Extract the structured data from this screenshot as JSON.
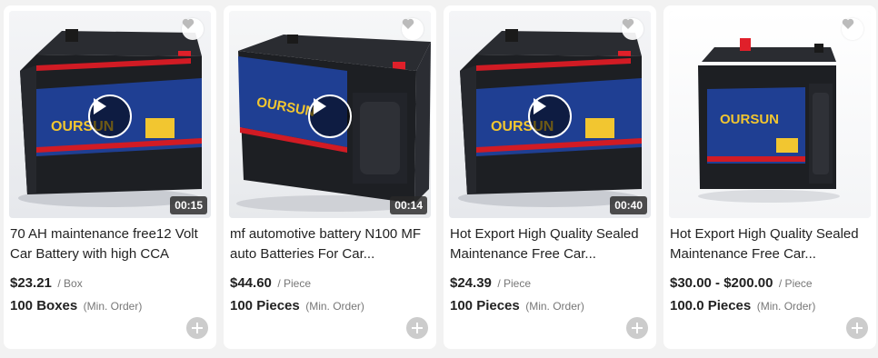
{
  "products": [
    {
      "title": "70 AH maintenance free12 Volt Car Battery with high CCA",
      "price": "$23.21",
      "unit": "/ Box",
      "moq": "100 Boxes",
      "moq_note": "(Min. Order)",
      "duration": "00:15",
      "has_video": true,
      "image_icon": "car-battery-image"
    },
    {
      "title": "mf automotive battery N100 MF auto Batteries For Car...",
      "price": "$44.60",
      "unit": "/ Piece",
      "moq": "100 Pieces",
      "moq_note": "(Min. Order)",
      "duration": "00:14",
      "has_video": true,
      "image_icon": "car-battery-image"
    },
    {
      "title": "Hot Export High Quality Sealed Maintenance Free Car...",
      "price": "$24.39",
      "unit": "/ Piece",
      "moq": "100 Pieces",
      "moq_note": "(Min. Order)",
      "duration": "00:40",
      "has_video": true,
      "image_icon": "car-battery-image"
    },
    {
      "title": "Hot Export High Quality Sealed Maintenance Free Car...",
      "price": "$30.00 - $200.00",
      "unit": "/ Piece",
      "moq": "100.0 Pieces",
      "moq_note": "(Min. Order)",
      "duration": "",
      "has_video": false,
      "image_icon": "car-battery-image"
    }
  ],
  "colors": {
    "battery_body": "#1d1f23",
    "battery_label": "#1f3f93",
    "battery_stripe": "#d11b24",
    "terminal_red": "#e0202a",
    "add_button": "#cccccc"
  },
  "brand": "OURSUN"
}
